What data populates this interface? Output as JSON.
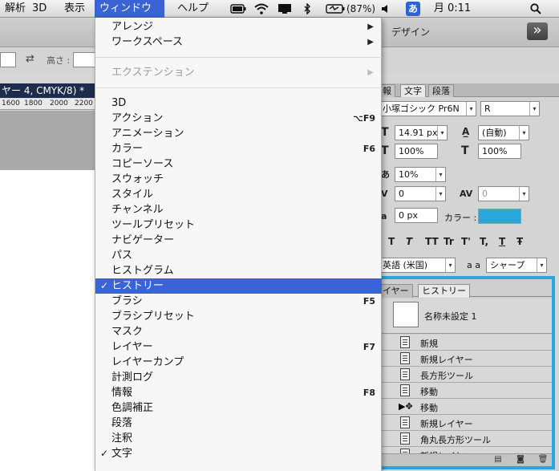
{
  "menubar": {
    "items": [
      "解析",
      "3D",
      "表示",
      "ウィンドウ",
      "ヘルプ"
    ],
    "active_index": 3,
    "status": {
      "battery": "(87%)",
      "input_method": "あ",
      "clock": "月 0:11"
    },
    "icons": [
      "battery-meter-icon",
      "wifi-icon",
      "display-icon",
      "bluetooth-icon",
      "battery-charging-icon",
      "volume-icon",
      "input-method-icon",
      "spotlight-search-icon"
    ]
  },
  "options_bar": {
    "design_label": "デザイン",
    "height_label": "高さ :",
    "collapse_glyph": "»"
  },
  "document": {
    "title": "ヤー 4, CMYK/8) *",
    "ruler_ticks": [
      "1600",
      "1800",
      "2000",
      "2200"
    ]
  },
  "text_panel": {
    "tabs": [
      "報",
      "文字",
      "段落"
    ],
    "active_tab": 1,
    "font_family": "小塚ゴシック Pr6N",
    "font_style": "R",
    "font_size": "14.91 px",
    "leading": "(自動)",
    "vertical_scale": "100%",
    "horizontal_scale": "100%",
    "tsume": "10%",
    "kerning": "0",
    "tracking": "0",
    "baseline_shift": "0 px",
    "color_label": "カラー :",
    "color": "#2BA6D9",
    "type_buttons": [
      "T",
      "T",
      "TT",
      "Tr",
      "T'",
      "T,",
      "T",
      "Ŧ"
    ],
    "language": "英語 (米国)",
    "aa_label": "a a",
    "antialias": "シャープ"
  },
  "history_panel": {
    "tabs": [
      "イヤー",
      "ヒストリー"
    ],
    "active_tab": 1,
    "snapshot_name": "名称未設定 1",
    "states": [
      "新規",
      "新規レイヤー",
      "長方形ツール",
      "移動",
      "移動",
      "新規レイヤー",
      "角丸長方形ツール",
      "新規レイヤー"
    ],
    "state_icons": [
      "state-icon",
      "state-icon",
      "state-icon",
      "state-icon",
      "move-icon",
      "state-icon",
      "state-icon",
      "state-icon"
    ],
    "highlight_color": "#29A6DF"
  },
  "window_menu": {
    "items": [
      {
        "label": "アレンジ",
        "submenu": true
      },
      {
        "label": "ワークスペース",
        "submenu": true
      },
      {
        "separator": true
      },
      {
        "label": "エクステンション",
        "submenu": true,
        "disabled": true
      },
      {
        "separator": true
      },
      {
        "label": "3D"
      },
      {
        "label": "アクション",
        "shortcut": "⌥F9"
      },
      {
        "label": "アニメーション"
      },
      {
        "label": "カラー",
        "shortcut": "F6"
      },
      {
        "label": "コピーソース"
      },
      {
        "label": "スウォッチ"
      },
      {
        "label": "スタイル"
      },
      {
        "label": "チャンネル"
      },
      {
        "label": "ツールプリセット"
      },
      {
        "label": "ナビゲーター"
      },
      {
        "label": "パス"
      },
      {
        "label": "ヒストグラム"
      },
      {
        "label": "ヒストリー",
        "checked": true,
        "highlighted": true
      },
      {
        "label": "ブラシ",
        "shortcut": "F5"
      },
      {
        "label": "ブラシプリセット"
      },
      {
        "label": "マスク"
      },
      {
        "label": "レイヤー",
        "shortcut": "F7"
      },
      {
        "label": "レイヤーカンプ"
      },
      {
        "label": "計測ログ"
      },
      {
        "label": "情報",
        "shortcut": "F8"
      },
      {
        "label": "色調補正"
      },
      {
        "label": "段落"
      },
      {
        "label": "注釈"
      },
      {
        "label": "文字",
        "checked": true
      }
    ],
    "highlight_color": "#3A63D6"
  }
}
